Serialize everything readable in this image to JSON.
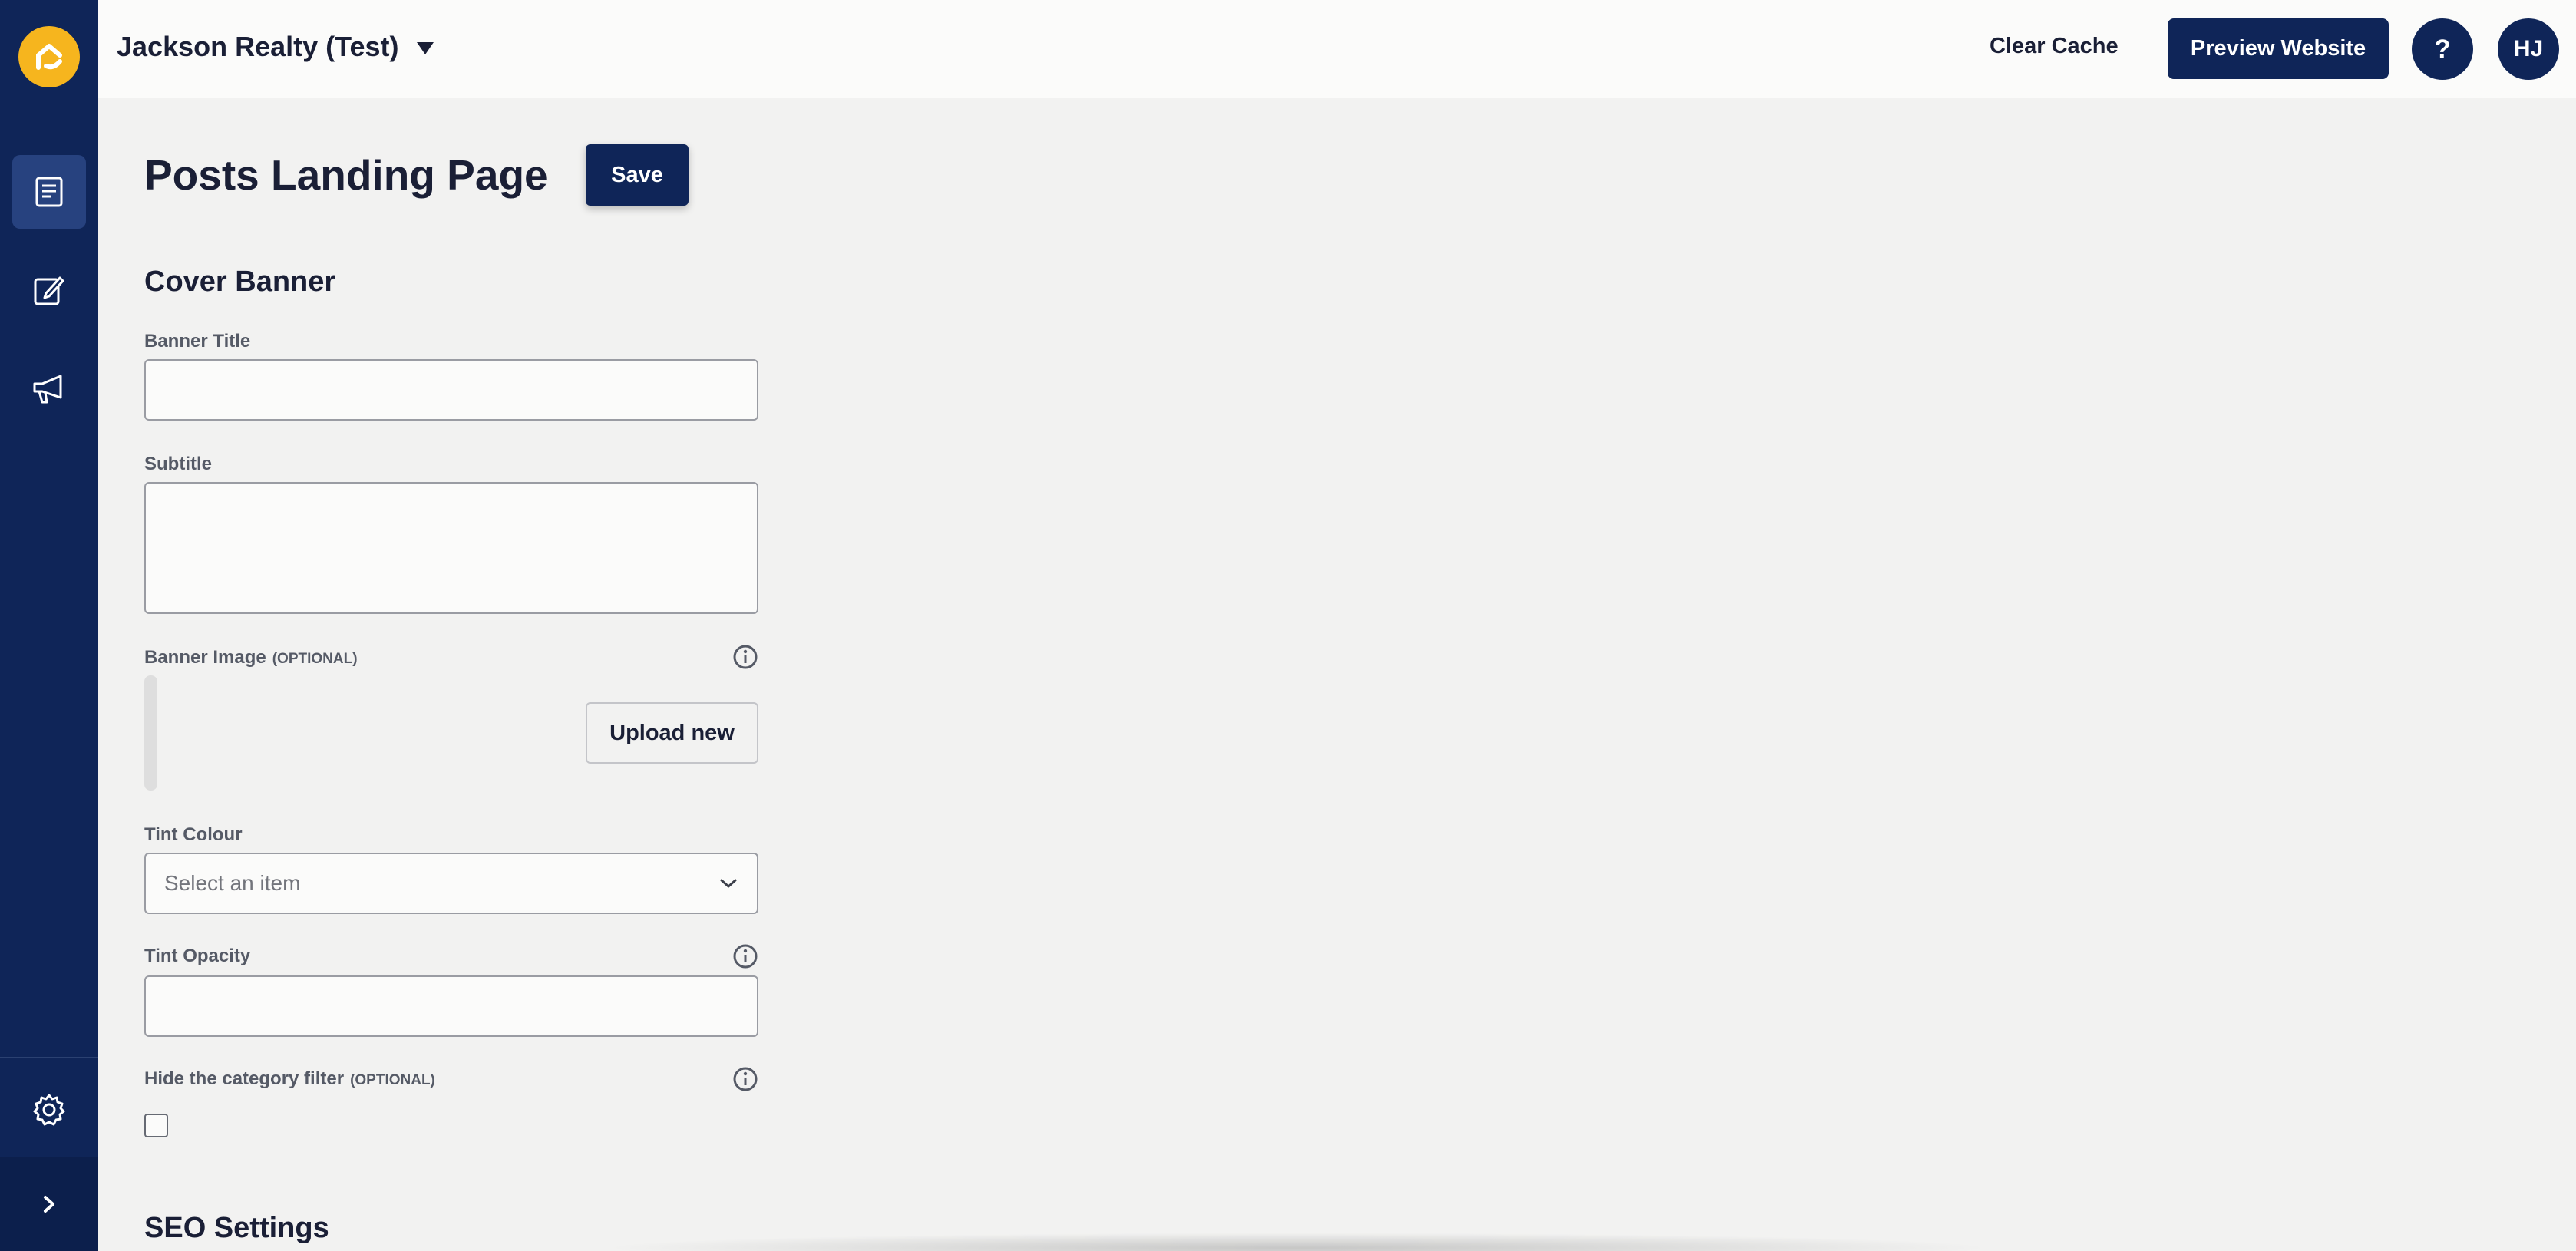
{
  "header": {
    "org_name": "Jackson Realty (Test)",
    "clear_cache_label": "Clear Cache",
    "preview_label": "Preview Website",
    "help_label": "?",
    "avatar_initials": "HJ"
  },
  "sidebar": {
    "items": [
      {
        "name": "pages",
        "icon": "document-icon",
        "active": true
      },
      {
        "name": "posts",
        "icon": "edit-icon",
        "active": false
      },
      {
        "name": "announcements",
        "icon": "megaphone-icon",
        "active": false
      }
    ],
    "settings_icon": "gear-icon",
    "expand_icon": "chevron-right-icon"
  },
  "page": {
    "title": "Posts Landing Page",
    "save_label": "Save"
  },
  "cover_banner": {
    "section_title": "Cover Banner",
    "banner_title_label": "Banner Title",
    "banner_title_value": "",
    "subtitle_label": "Subtitle",
    "subtitle_value": "",
    "banner_image_label": "Banner Image",
    "optional_tag": "(OPTIONAL)",
    "upload_label": "Upload new",
    "tint_colour_label": "Tint Colour",
    "tint_colour_placeholder": "Select an item",
    "tint_opacity_label": "Tint Opacity",
    "tint_opacity_value": "",
    "hide_filter_label": "Hide the category filter",
    "hide_filter_optional": "(OPTIONAL)",
    "hide_filter_checked": false
  },
  "seo": {
    "section_title": "SEO Settings"
  },
  "colors": {
    "sidebar": "#0f2558",
    "primary": "#0f2558",
    "logo": "#f6b51e",
    "background": "#f2f2f1"
  }
}
